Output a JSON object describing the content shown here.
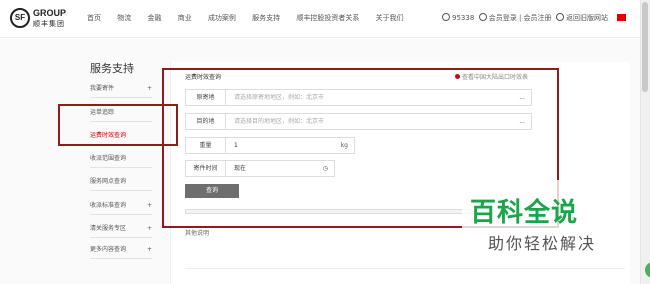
{
  "header": {
    "logo": {
      "mark": "SF",
      "en": "GROUP",
      "cn": "顺丰集团"
    },
    "nav": [
      "首页",
      "物流",
      "金融",
      "商业",
      "成功案例",
      "服务支持",
      "顺丰控股投资者关系",
      "关于我们"
    ],
    "phone": "95338",
    "login": "会员登录",
    "register": "会员注册",
    "old_site": "返回旧版网站"
  },
  "sidebar": {
    "title": "服务支持",
    "items": [
      {
        "label": "我要寄件",
        "plus": "+"
      },
      {
        "label": "运单追踪",
        "plus": ""
      },
      {
        "label": "运费时效查询",
        "plus": ""
      },
      {
        "label": "收派范围查询",
        "plus": ""
      },
      {
        "label": "服务网点查询",
        "plus": ""
      },
      {
        "label": "收派标准查询",
        "plus": "+"
      },
      {
        "label": "清关服务专区",
        "plus": "+"
      },
      {
        "label": "更多内容查询",
        "plus": "+"
      }
    ]
  },
  "panel": {
    "title": "运费时效查询",
    "link": "查看中国大陆出口时效表",
    "origin": {
      "label": "原寄地",
      "placeholder": "请选择原寄地地区，例如：北京市",
      "tail": "..."
    },
    "destination": {
      "label": "目的地",
      "placeholder": "请选择目的地地区，例如：北京市",
      "tail": "..."
    },
    "weight": {
      "label": "重量",
      "value": "1",
      "unit": "kg"
    },
    "send_time": {
      "label": "寄件时间",
      "value": "现在"
    },
    "query_button": "查询",
    "result_label": "其他说明"
  },
  "watermark": {
    "title": "百科全说",
    "subtitle": "助你轻松解决"
  },
  "colors": {
    "highlight": "#8f1c1c",
    "watermark": "#1aa54a",
    "active_menu": "#cc0000",
    "button": "#6e6e6e"
  }
}
